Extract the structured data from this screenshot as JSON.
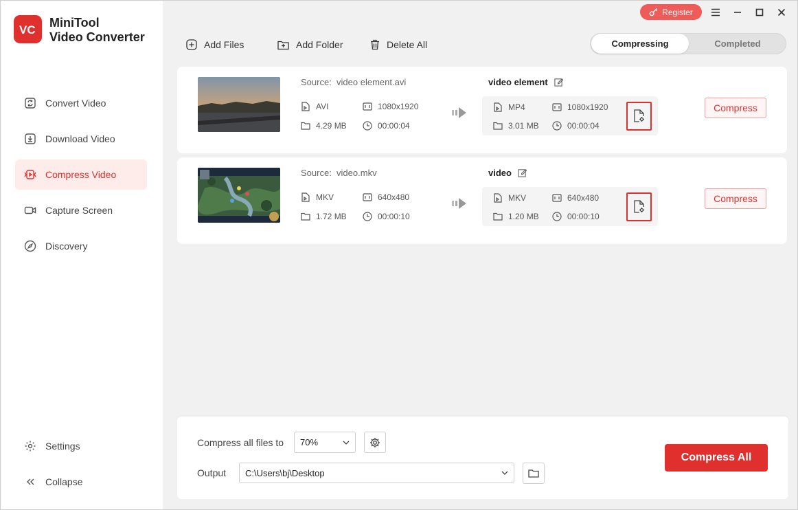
{
  "app": {
    "logo_text": "VC",
    "name_line1": "MiniTool",
    "name_line2": "Video Converter"
  },
  "sidebar": {
    "items": [
      {
        "label": "Convert Video",
        "icon": "convert-icon"
      },
      {
        "label": "Download Video",
        "icon": "download-icon"
      },
      {
        "label": "Compress Video",
        "icon": "compress-icon",
        "active": true
      },
      {
        "label": "Capture Screen",
        "icon": "camera-icon"
      },
      {
        "label": "Discovery",
        "icon": "compass-icon"
      }
    ],
    "settings_label": "Settings",
    "collapse_label": "Collapse"
  },
  "titlebar": {
    "register_label": "Register"
  },
  "toolbar": {
    "add_files": "Add Files",
    "add_folder": "Add Folder",
    "delete_all": "Delete All"
  },
  "tabs": {
    "compressing": "Compressing",
    "completed": "Completed"
  },
  "files": [
    {
      "source_label": "Source:",
      "source_name": "video element.avi",
      "src_format": "AVI",
      "src_resolution": "1080x1920",
      "src_size": "4.29 MB",
      "src_duration": "00:00:04",
      "output_name": "video element",
      "out_format": "MP4",
      "out_resolution": "1080x1920",
      "out_size": "3.01 MB",
      "out_duration": "00:00:04",
      "compress_label": "Compress"
    },
    {
      "source_label": "Source:",
      "source_name": "video.mkv",
      "src_format": "MKV",
      "src_resolution": "640x480",
      "src_size": "1.72 MB",
      "src_duration": "00:00:10",
      "output_name": "video",
      "out_format": "MKV",
      "out_resolution": "640x480",
      "out_size": "1.20 MB",
      "out_duration": "00:00:10",
      "compress_label": "Compress"
    }
  ],
  "bottom": {
    "compress_all_to_label": "Compress all files to",
    "ratio_value": "70%",
    "output_label": "Output",
    "output_path": "C:\\Users\\bj\\Desktop",
    "compress_all_label": "Compress All"
  },
  "colors": {
    "accent": "#e0302e",
    "register": "#ee5c5a",
    "panel_bg": "#f1f1f1"
  }
}
